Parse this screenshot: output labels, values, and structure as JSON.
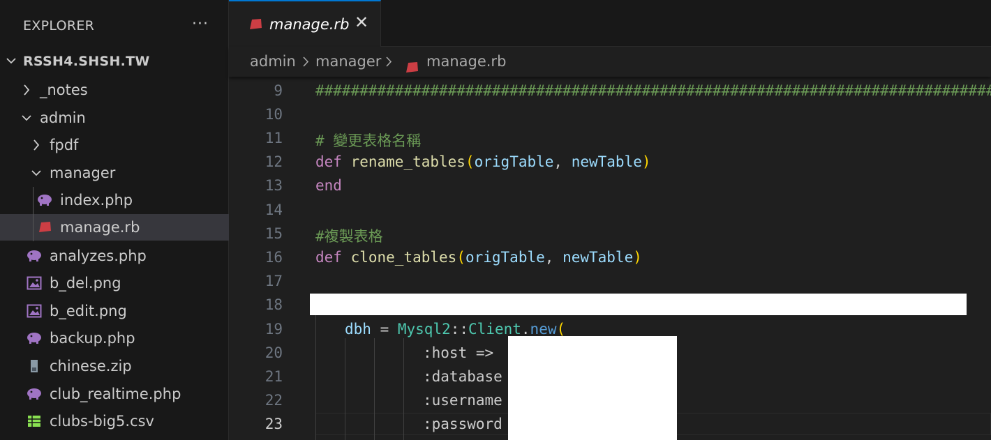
{
  "sidebar": {
    "title": "EXPLORER",
    "more_label": "···",
    "root_label": "RSSH4.SHSH.TW",
    "items": [
      {
        "label": "_notes",
        "type": "folder",
        "expanded": false
      },
      {
        "label": "admin",
        "type": "folder",
        "expanded": true
      },
      {
        "label": "fpdf",
        "type": "folder",
        "expanded": false
      },
      {
        "label": "manager",
        "type": "folder",
        "expanded": true
      },
      {
        "label": "index.php",
        "type": "php-file"
      },
      {
        "label": "manage.rb",
        "type": "ruby-file",
        "selected": true
      },
      {
        "label": "analyzes.php",
        "type": "php-file"
      },
      {
        "label": "b_del.png",
        "type": "image-file"
      },
      {
        "label": "b_edit.png",
        "type": "image-file"
      },
      {
        "label": "backup.php",
        "type": "php-file"
      },
      {
        "label": "chinese.zip",
        "type": "zip-file"
      },
      {
        "label": "club_realtime.php",
        "type": "php-file"
      },
      {
        "label": "clubs-big5.csv",
        "type": "csv-file"
      }
    ]
  },
  "tab": {
    "label": "manage.rb",
    "close_label": "✕"
  },
  "breadcrumb": {
    "parts": [
      "admin",
      "manager",
      "manage.rb"
    ],
    "separator": "›"
  },
  "editor": {
    "active_line": "23",
    "line_numbers": [
      "9",
      "10",
      "11",
      "12",
      "13",
      "14",
      "15",
      "16",
      "17",
      "18",
      "19",
      "20",
      "21",
      "22",
      "23"
    ],
    "lines": {
      "l9": "###########################################################################################",
      "l11": "# 變更表格名稱",
      "l12_kw": "def",
      "l12_fn": "rename_tables",
      "l12_p1": "origTable",
      "l12_p2": "newTable",
      "l13_kw": "end",
      "l15": "#複製表格",
      "l16_kw": "def",
      "l16_fn": "clone_tables",
      "l16_p1": "origTable",
      "l16_p2": "newTable",
      "l19_var": "dbh",
      "l19_op": " = ",
      "l19_mod": "Mysql2",
      "l19_sep": "::",
      "l19_cls": "Client",
      "l19_dot": ".",
      "l19_method": "new",
      "l20": ":host =>",
      "l21": ":database",
      "l22": ":username",
      "l23": ":password"
    }
  },
  "colors": {
    "accent": "#0078d4",
    "ruby_icon": "#cc3e44",
    "php_icon": "#a074c4",
    "image_icon": "#a074c4",
    "csv_icon": "#89e051"
  }
}
